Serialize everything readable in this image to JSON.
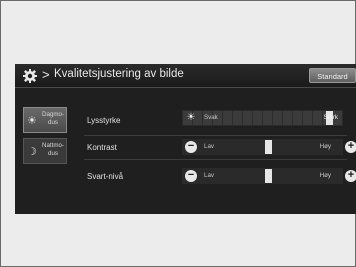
{
  "header": {
    "title": "Kvalitetsjustering av bilde",
    "standard_button": "Standard",
    "chevron": ">"
  },
  "modes": [
    {
      "label_line1": "Dagmo-",
      "label_line2": "dus",
      "icon": "sun-icon",
      "selected": true
    },
    {
      "label_line1": "Nattmo-",
      "label_line2": "dus",
      "icon": "moon-icon",
      "selected": false
    }
  ],
  "settings": [
    {
      "label": "Lysstyrke",
      "low": "Svak",
      "high": "Sterk",
      "level": 0.92
    },
    {
      "label": "Kontrast",
      "low": "Lav",
      "high": "Høy",
      "level": 0.5
    },
    {
      "label": "Svart-nivå",
      "low": "Lav",
      "high": "Høy",
      "level": 0.5
    }
  ],
  "colors": {
    "screen_bg": "#1f1f1f",
    "accent_thumb": "#e6e6e6"
  }
}
